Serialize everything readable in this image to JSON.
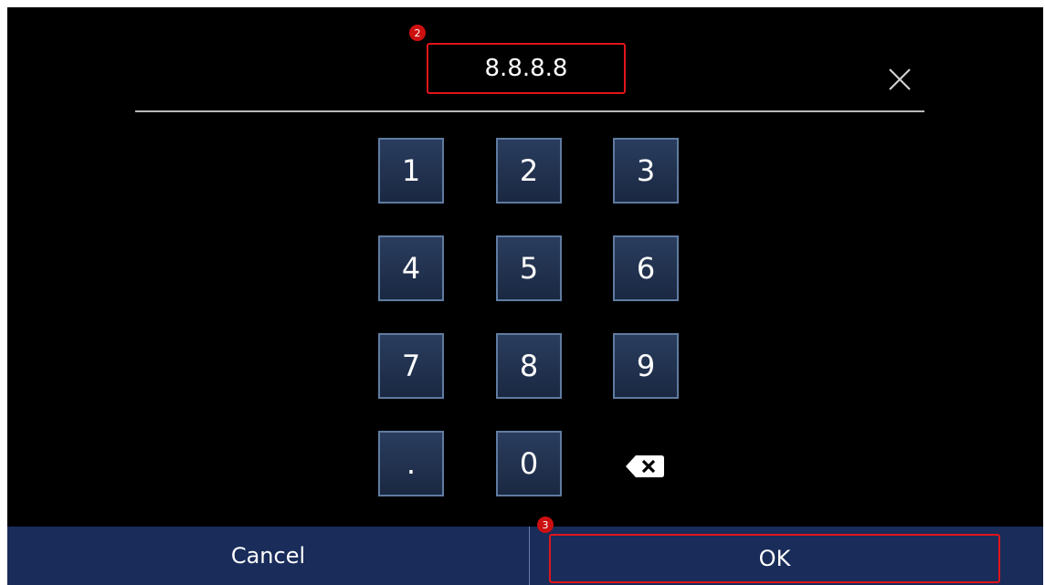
{
  "input": {
    "value": "8.8.8.8",
    "badge": "2"
  },
  "keypad": {
    "keys": [
      "1",
      "2",
      "3",
      "4",
      "5",
      "6",
      "7",
      "8",
      "9",
      ".",
      "0"
    ]
  },
  "icons": {
    "close": "close-icon",
    "backspace": "backspace-icon"
  },
  "footer": {
    "cancel_label": "Cancel",
    "ok_label": "OK",
    "ok_badge": "3"
  },
  "colors": {
    "background": "#000000",
    "key_fill": "#22334f",
    "key_border": "#5f7ba0",
    "bottom_bar": "#192c5a",
    "highlight": "#e0151a"
  }
}
